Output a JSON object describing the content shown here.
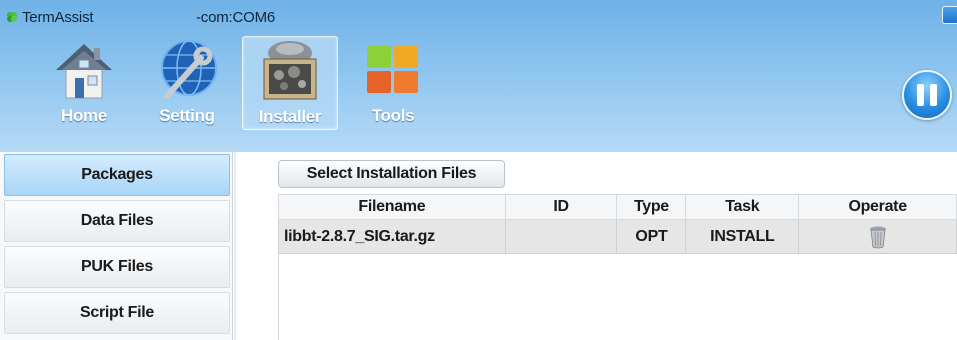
{
  "window": {
    "app_title": "TermAssist",
    "port": "-com:COM6"
  },
  "nav": {
    "items": [
      {
        "label": "Home",
        "icon": "house-icon",
        "active": false
      },
      {
        "label": "Setting",
        "icon": "wrench-globe-icon",
        "active": false
      },
      {
        "label": "Installer",
        "icon": "installer-icon",
        "active": true
      },
      {
        "label": "Tools",
        "icon": "tools-tiles-icon",
        "active": false
      }
    ],
    "pause_icon": "pause-icon"
  },
  "sidebar": {
    "items": [
      {
        "label": "Packages",
        "active": true
      },
      {
        "label": "Data Files",
        "active": false
      },
      {
        "label": "PUK Files",
        "active": false
      },
      {
        "label": "Script File",
        "active": false
      }
    ]
  },
  "main": {
    "select_button_label": "Select Installation Files",
    "table": {
      "columns": [
        "Filename",
        "ID",
        "Type",
        "Task",
        "Operate"
      ],
      "rows": [
        {
          "filename": "libbt-2.8.7_SIG.tar.gz",
          "id": "",
          "type": "OPT",
          "task": "INSTALL",
          "operate_icon": "trash-icon"
        }
      ]
    }
  },
  "colors": {
    "header_top": "#6fb1e6",
    "header_bottom": "#b5daf7",
    "sidebar_active": "#a9d5f7",
    "row_background": "#e6e6e6"
  }
}
